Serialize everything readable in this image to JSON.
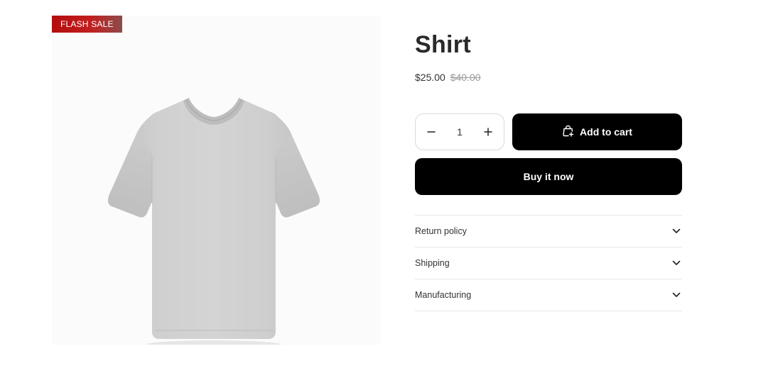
{
  "product": {
    "badge": "FLASH SALE",
    "title": "Shirt",
    "price_current": "$25.00",
    "price_old": "$40.00",
    "image_icon": "t-shirt-image",
    "image_color": "#cfcfcf"
  },
  "quantity": {
    "value": "1",
    "decrease_icon": "minus-icon",
    "increase_icon": "plus-icon"
  },
  "buttons": {
    "add_to_cart": "Add to cart",
    "add_to_cart_icon": "bag-plus-icon",
    "buy_now": "Buy it now"
  },
  "accordion": [
    {
      "label": "Return policy"
    },
    {
      "label": "Shipping"
    },
    {
      "label": "Manufacturing"
    }
  ],
  "colors": {
    "badge": "#b30d0d",
    "primary_button": "#000000"
  }
}
